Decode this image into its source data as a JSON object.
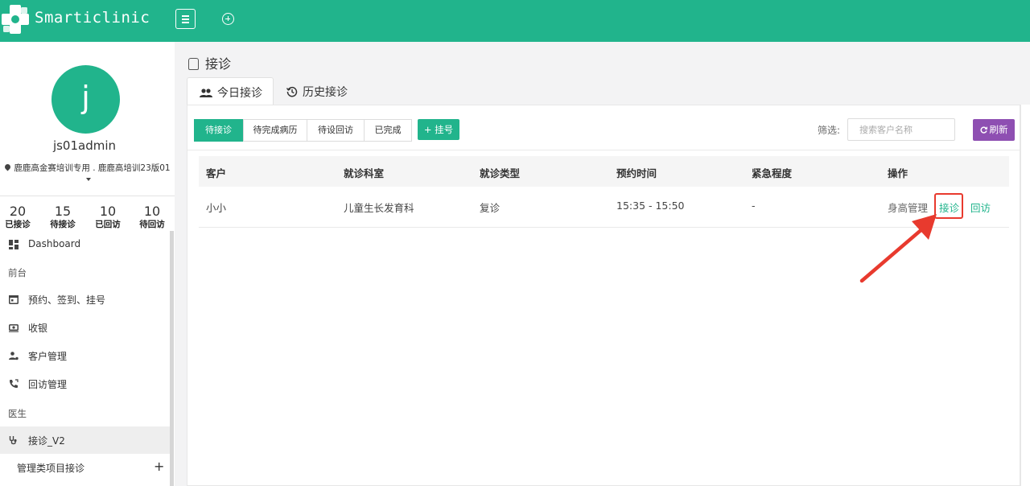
{
  "app": {
    "brand": "Smarticlinic"
  },
  "user": {
    "avatar_initial": "j",
    "name": "js01admin",
    "clinic": "鹿鹿高金赛培训专用 . 鹿鹿高培训23版01"
  },
  "stats": [
    {
      "value": "20",
      "label": "已接诊"
    },
    {
      "value": "15",
      "label": "待接诊"
    },
    {
      "value": "10",
      "label": "已回访"
    },
    {
      "value": "10",
      "label": "待回访"
    }
  ],
  "nav": {
    "dashboard": "Dashboard",
    "section_front": "前台",
    "appointments": "预约、签到、挂号",
    "cashier": "收银",
    "customers": "客户管理",
    "followup": "回访管理",
    "section_doctor": "医生",
    "reception_v2": "接诊_V2",
    "management_reception": "管理类项目接诊"
  },
  "page": {
    "title": "接诊",
    "tabs": [
      "今日接诊",
      "历史接诊"
    ]
  },
  "filters": {
    "segments": [
      "待接诊",
      "待完成病历",
      "待设回访",
      "已完成"
    ],
    "register_label": "+ 挂号",
    "filter_label": "筛选:",
    "search_placeholder": "搜索客户名称",
    "refresh_label": "刷新"
  },
  "table": {
    "headers": [
      "客户",
      "就诊科室",
      "就诊类型",
      "预约时间",
      "紧急程度",
      "操作"
    ],
    "rows": [
      {
        "customer": "小小",
        "department": "儿童生长发育科",
        "visit_type": "复诊",
        "time": "15:35 - 15:50",
        "urgency": "-",
        "actions": [
          "身高管理",
          "接诊",
          "回访"
        ]
      }
    ]
  },
  "colors": {
    "primary": "#21b48c",
    "refresh": "#8e4fb2",
    "annotation": "#e83a2e"
  }
}
